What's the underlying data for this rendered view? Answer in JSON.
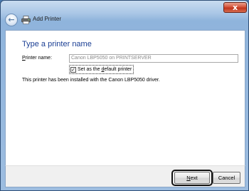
{
  "window": {
    "title": "Add Printer",
    "close_label": "x"
  },
  "header": {
    "back_glyph": "←"
  },
  "page": {
    "heading": "Type a printer name",
    "printer_name_label_accel": "P",
    "printer_name_label_rest": "rinter name:",
    "printer_name_value": "Canon LBP5050 on PRINTSERVER",
    "default_checkbox_checked": true,
    "default_checkbox_mark": "✓",
    "default_label_pre": "Set as the ",
    "default_label_accel": "d",
    "default_label_post": "efault printer",
    "info": "This printer has been installed with the Canon LBP5050 driver."
  },
  "footer": {
    "next_accel": "N",
    "next_rest": "ext",
    "cancel_label": "Cancel"
  },
  "colors": {
    "heading": "#1a3e93",
    "frame": "#9dbde0",
    "close": "#c0341d"
  },
  "icons": {
    "back": "back-arrow-icon",
    "printer": "printer-icon",
    "close": "close-icon",
    "checkmark": "checkmark-icon"
  }
}
